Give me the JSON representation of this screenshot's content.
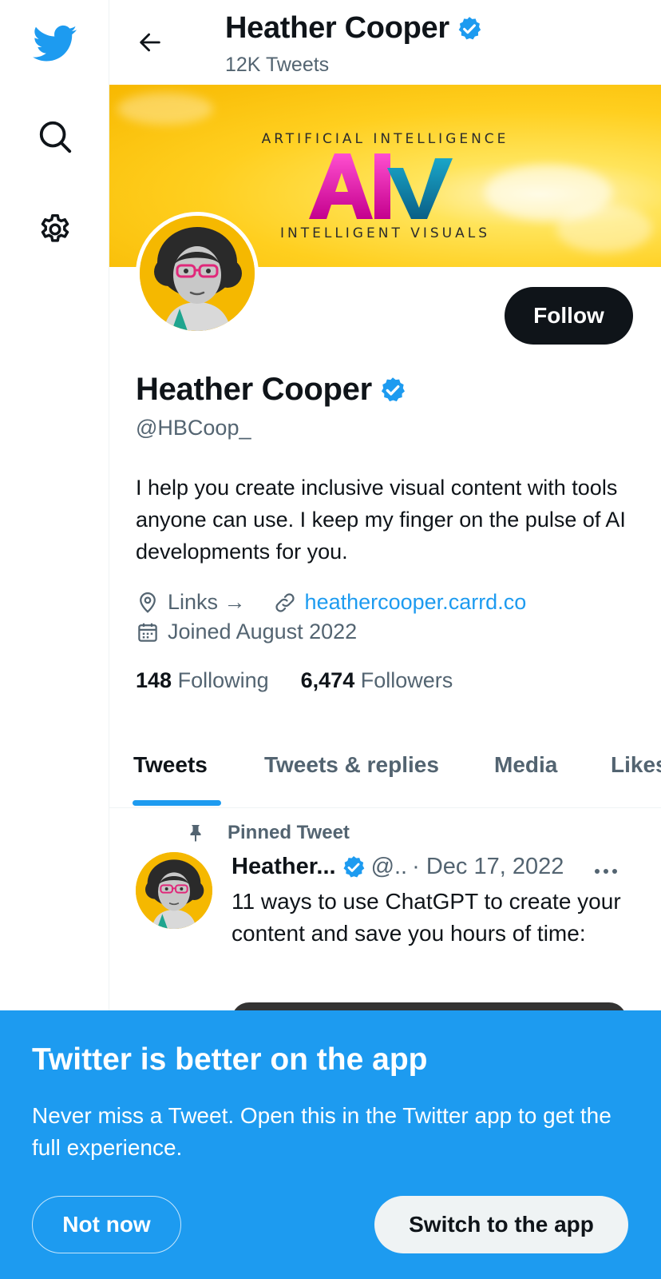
{
  "nav": {
    "icons": [
      "twitter-bird-icon",
      "search-icon",
      "settings-gear-icon"
    ]
  },
  "header": {
    "name": "Heather Cooper",
    "tweet_count": "12K Tweets"
  },
  "banner": {
    "top_text": "ARTIFICIAL INTELLIGENCE",
    "logo_text": "AIV",
    "bottom_text": "INTELLIGENT VISUALS"
  },
  "profile": {
    "follow_label": "Follow",
    "name": "Heather Cooper",
    "handle": "@HBCoop_",
    "bio": "I help you create inclusive visual content with tools anyone can use. I keep my finger on the pulse of AI developments for you.",
    "location": "Links →",
    "website": "heathercooper.carrd.co",
    "joined": "Joined August 2022",
    "following_count": "148",
    "following_label": "Following",
    "followers_count": "6,474",
    "followers_label": "Followers"
  },
  "tabs": [
    {
      "label": "Tweets",
      "active": true
    },
    {
      "label": "Tweets & replies",
      "active": false
    },
    {
      "label": "Media",
      "active": false
    },
    {
      "label": "Likes",
      "active": false
    }
  ],
  "pinned": {
    "label": "Pinned Tweet",
    "author": "Heather...",
    "handle": "@..",
    "date": "· Dec 17, 2022",
    "text": "11 ways to use ChatGPT to create your content and save you hours of time:"
  },
  "app_banner": {
    "title": "Twitter is better on the app",
    "description": "Never miss a Tweet. Open this in the Twitter app to get the full experience.",
    "not_now_label": "Not now",
    "switch_label": "Switch to the app"
  },
  "colors": {
    "accent": "#1d9bf0",
    "text": "#0f1419",
    "muted": "#536471",
    "banner_yellow": "#ffcf1f"
  }
}
